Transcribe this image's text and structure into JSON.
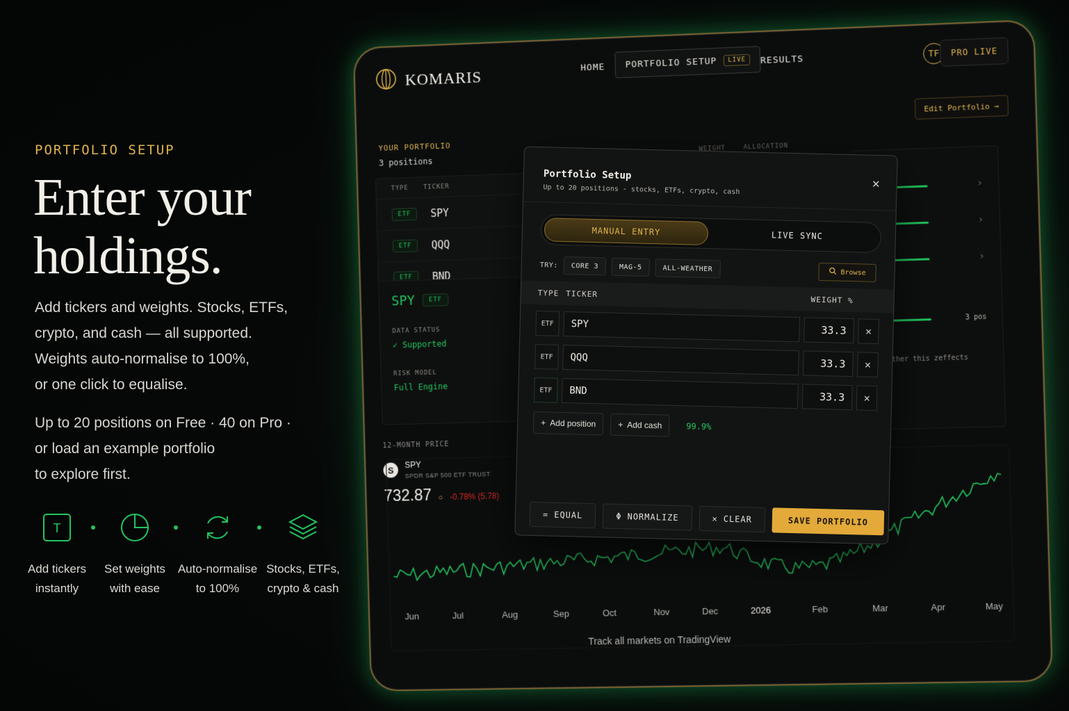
{
  "intro": {
    "eyebrow": "PORTFOLIO SETUP",
    "headline_line1": "Enter your",
    "headline_line2": "holdings.",
    "para1": [
      "Add tickers and weights. Stocks, ETFs,",
      "crypto, and cash — all supported.",
      "Weights auto-normalise to 100%,",
      "or one click to equalise."
    ],
    "para2": [
      "Up to 20 positions on Free · 40 on Pro ·",
      "or load an example portfolio",
      "to explore first."
    ],
    "features": [
      {
        "icon": "text-cursor-icon",
        "line1": "Add tickers",
        "line2": "instantly"
      },
      {
        "icon": "pie-chart-icon",
        "line1": "Set weights",
        "line2": "with ease"
      },
      {
        "icon": "refresh-icon",
        "line1": "Auto-normalise",
        "line2": "to 100%"
      },
      {
        "icon": "layers-icon",
        "line1": "Stocks, ETFs,",
        "line2": "crypto & cash"
      }
    ],
    "icon_letter": "T"
  },
  "app": {
    "brand": "KOMARIS",
    "nav": {
      "home": "HOME",
      "setup": "PORTFOLIO SETUP",
      "setup_badge": "LIVE",
      "results": "RESULTS"
    },
    "avatar": "TF",
    "plan": "PRO LIVE",
    "edit_portfolio": "Edit Portfolio →",
    "portfolio": {
      "title": "YOUR PORTFOLIO",
      "count": "3 positions"
    },
    "holdings_header": {
      "type": "TYPE",
      "ticker": "TICKER"
    },
    "holdings": [
      {
        "type": "ETF",
        "ticker": "SPY"
      },
      {
        "type": "ETF",
        "ticker": "QQQ"
      },
      {
        "type": "ETF",
        "ticker": "BND"
      }
    ],
    "detail": {
      "ticker": "SPY",
      "type": "ETF",
      "status_label": "DATA STATUS",
      "status_value": "✓ Supported",
      "risk_label": "RISK MODEL",
      "risk_value": "Full Engine"
    },
    "price": {
      "label": "12-MONTH PRICE",
      "logo": "S",
      "symbol": "SPY",
      "name": "SPDR S&P 500 ETF TRUST",
      "value": "732.87",
      "unit": "○",
      "change": "-0.78% (5.78)"
    },
    "allocation_header": {
      "weight": "WEIGHT",
      "allocation": "ALLOCATION"
    },
    "right_panel": {
      "positions": "3 pos",
      "note": "ther whether this zeffects"
    },
    "chart": {
      "months": [
        "Jun",
        "Jul",
        "Aug",
        "Sep",
        "Oct",
        "Nov",
        "Dec",
        "2026",
        "Feb",
        "Mar",
        "Apr",
        "May"
      ],
      "footer": "Track all markets on TradingView",
      "line_color": "#22c55e"
    }
  },
  "modal": {
    "title": "Portfolio Setup",
    "subtitle": "Up to 20 positions - stocks, ETFs, crypto, cash",
    "tabs": {
      "manual": "MANUAL ENTRY",
      "live": "LIVE SYNC"
    },
    "try_label": "TRY:",
    "presets": [
      "CORE 3",
      "MAG-5",
      "ALL-WEATHER"
    ],
    "browse": "Browse",
    "columns": {
      "type": "TYPE",
      "ticker": "TICKER",
      "weight": "WEIGHT %"
    },
    "rows": [
      {
        "type": "ETF",
        "ticker": "SPY",
        "weight": "33.3"
      },
      {
        "type": "ETF",
        "ticker": "QQQ",
        "weight": "33.3"
      },
      {
        "type": "ETF",
        "ticker": "BND",
        "weight": "33.3"
      }
    ],
    "add_position": "Add position",
    "add_cash": "Add cash",
    "total": "99.9%",
    "footer": {
      "equal": "EQUAL",
      "normalize": "NORMALIZE",
      "clear": "CLEAR",
      "save": "SAVE PORTFOLIO"
    }
  },
  "colors": {
    "accent_gold": "#e0b44c",
    "accent_green": "#22c55e",
    "negative": "#dc2626",
    "background": "#050607"
  }
}
